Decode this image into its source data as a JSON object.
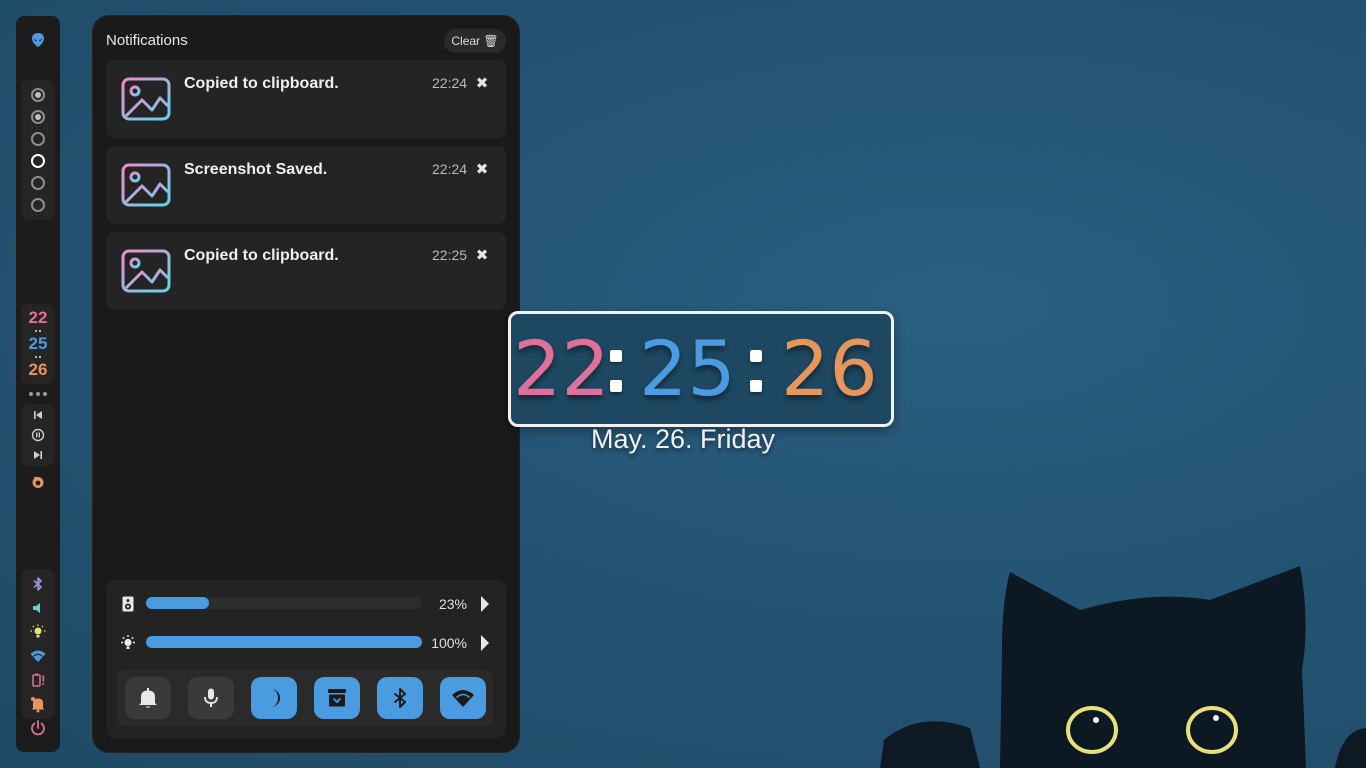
{
  "sidebar": {
    "logo_icon": "alien-icon",
    "workspaces": [
      {
        "state": "occupied"
      },
      {
        "state": "occupied"
      },
      {
        "state": "empty"
      },
      {
        "state": "active"
      },
      {
        "state": "empty"
      },
      {
        "state": "empty"
      }
    ],
    "clock": {
      "hours": "22",
      "minutes": "25",
      "seconds": "26"
    },
    "media": [
      "previous-icon",
      "pause-icon",
      "next-icon"
    ],
    "app_icon": "firefox-icon",
    "status_icons": [
      "bluetooth-icon",
      "volume-icon",
      "brightness-icon",
      "wifi-icon",
      "battery-alert-icon",
      "notification-bell-icon"
    ],
    "power_icon": "power-icon"
  },
  "notifications": {
    "title": "Notifications",
    "clear_label": "Clear 🗑",
    "items": [
      {
        "text": "Copied to clipboard.",
        "time": "22:24",
        "icon": "image-icon"
      },
      {
        "text": "Screenshot Saved.",
        "time": "22:24",
        "icon": "image-icon"
      },
      {
        "text": "Copied to clipboard.",
        "time": "22:25",
        "icon": "image-icon"
      }
    ]
  },
  "sliders": {
    "volume": {
      "label": "23%",
      "value": 0.23,
      "icon": "speaker-icon"
    },
    "brightness": {
      "label": "100%",
      "value": 1.0,
      "icon": "brightness-icon"
    }
  },
  "toggles": [
    {
      "icon": "bell-icon",
      "on": false
    },
    {
      "icon": "microphone-icon",
      "on": false
    },
    {
      "icon": "moon-icon",
      "on": true
    },
    {
      "icon": "archive-icon",
      "on": true
    },
    {
      "icon": "bluetooth-icon",
      "on": true
    },
    {
      "icon": "wifi-icon",
      "on": true
    }
  ],
  "desktop_clock": {
    "hours": "22",
    "minutes": "25",
    "seconds": "26",
    "date": "May. 26. Friday"
  },
  "colors": {
    "hours": "#e0709a",
    "minutes": "#4a9be0",
    "seconds": "#e8955a",
    "accent": "#4a9be0"
  }
}
